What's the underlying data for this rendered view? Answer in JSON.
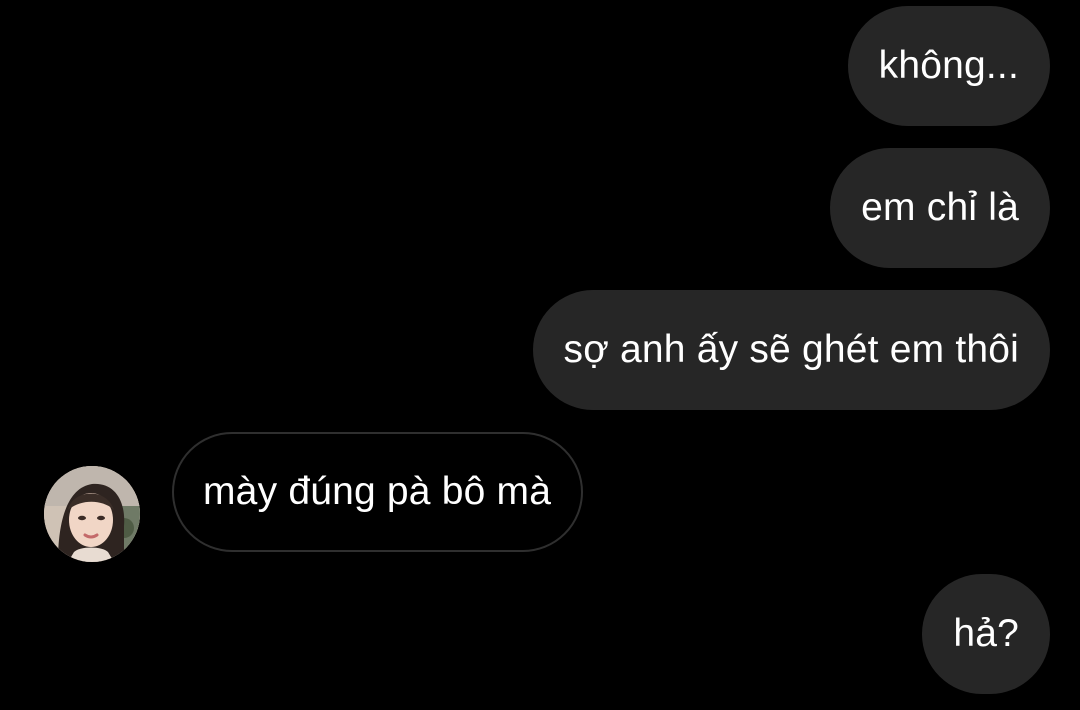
{
  "conversation": {
    "messages": [
      {
        "direction": "outgoing",
        "text": "không..."
      },
      {
        "direction": "outgoing",
        "text": "em chỉ là"
      },
      {
        "direction": "outgoing",
        "text": "sợ anh ấy sẽ ghét em thôi"
      },
      {
        "direction": "incoming",
        "text": "mày đúng pà bô mà"
      },
      {
        "direction": "outgoing",
        "text": "hả?"
      }
    ]
  },
  "theme": {
    "background": "#000000",
    "outgoing_bubble": "#262626",
    "incoming_border": "#2f2f2f",
    "text": "#ffffff"
  },
  "avatar": {
    "icon": "profile-photo-icon"
  }
}
